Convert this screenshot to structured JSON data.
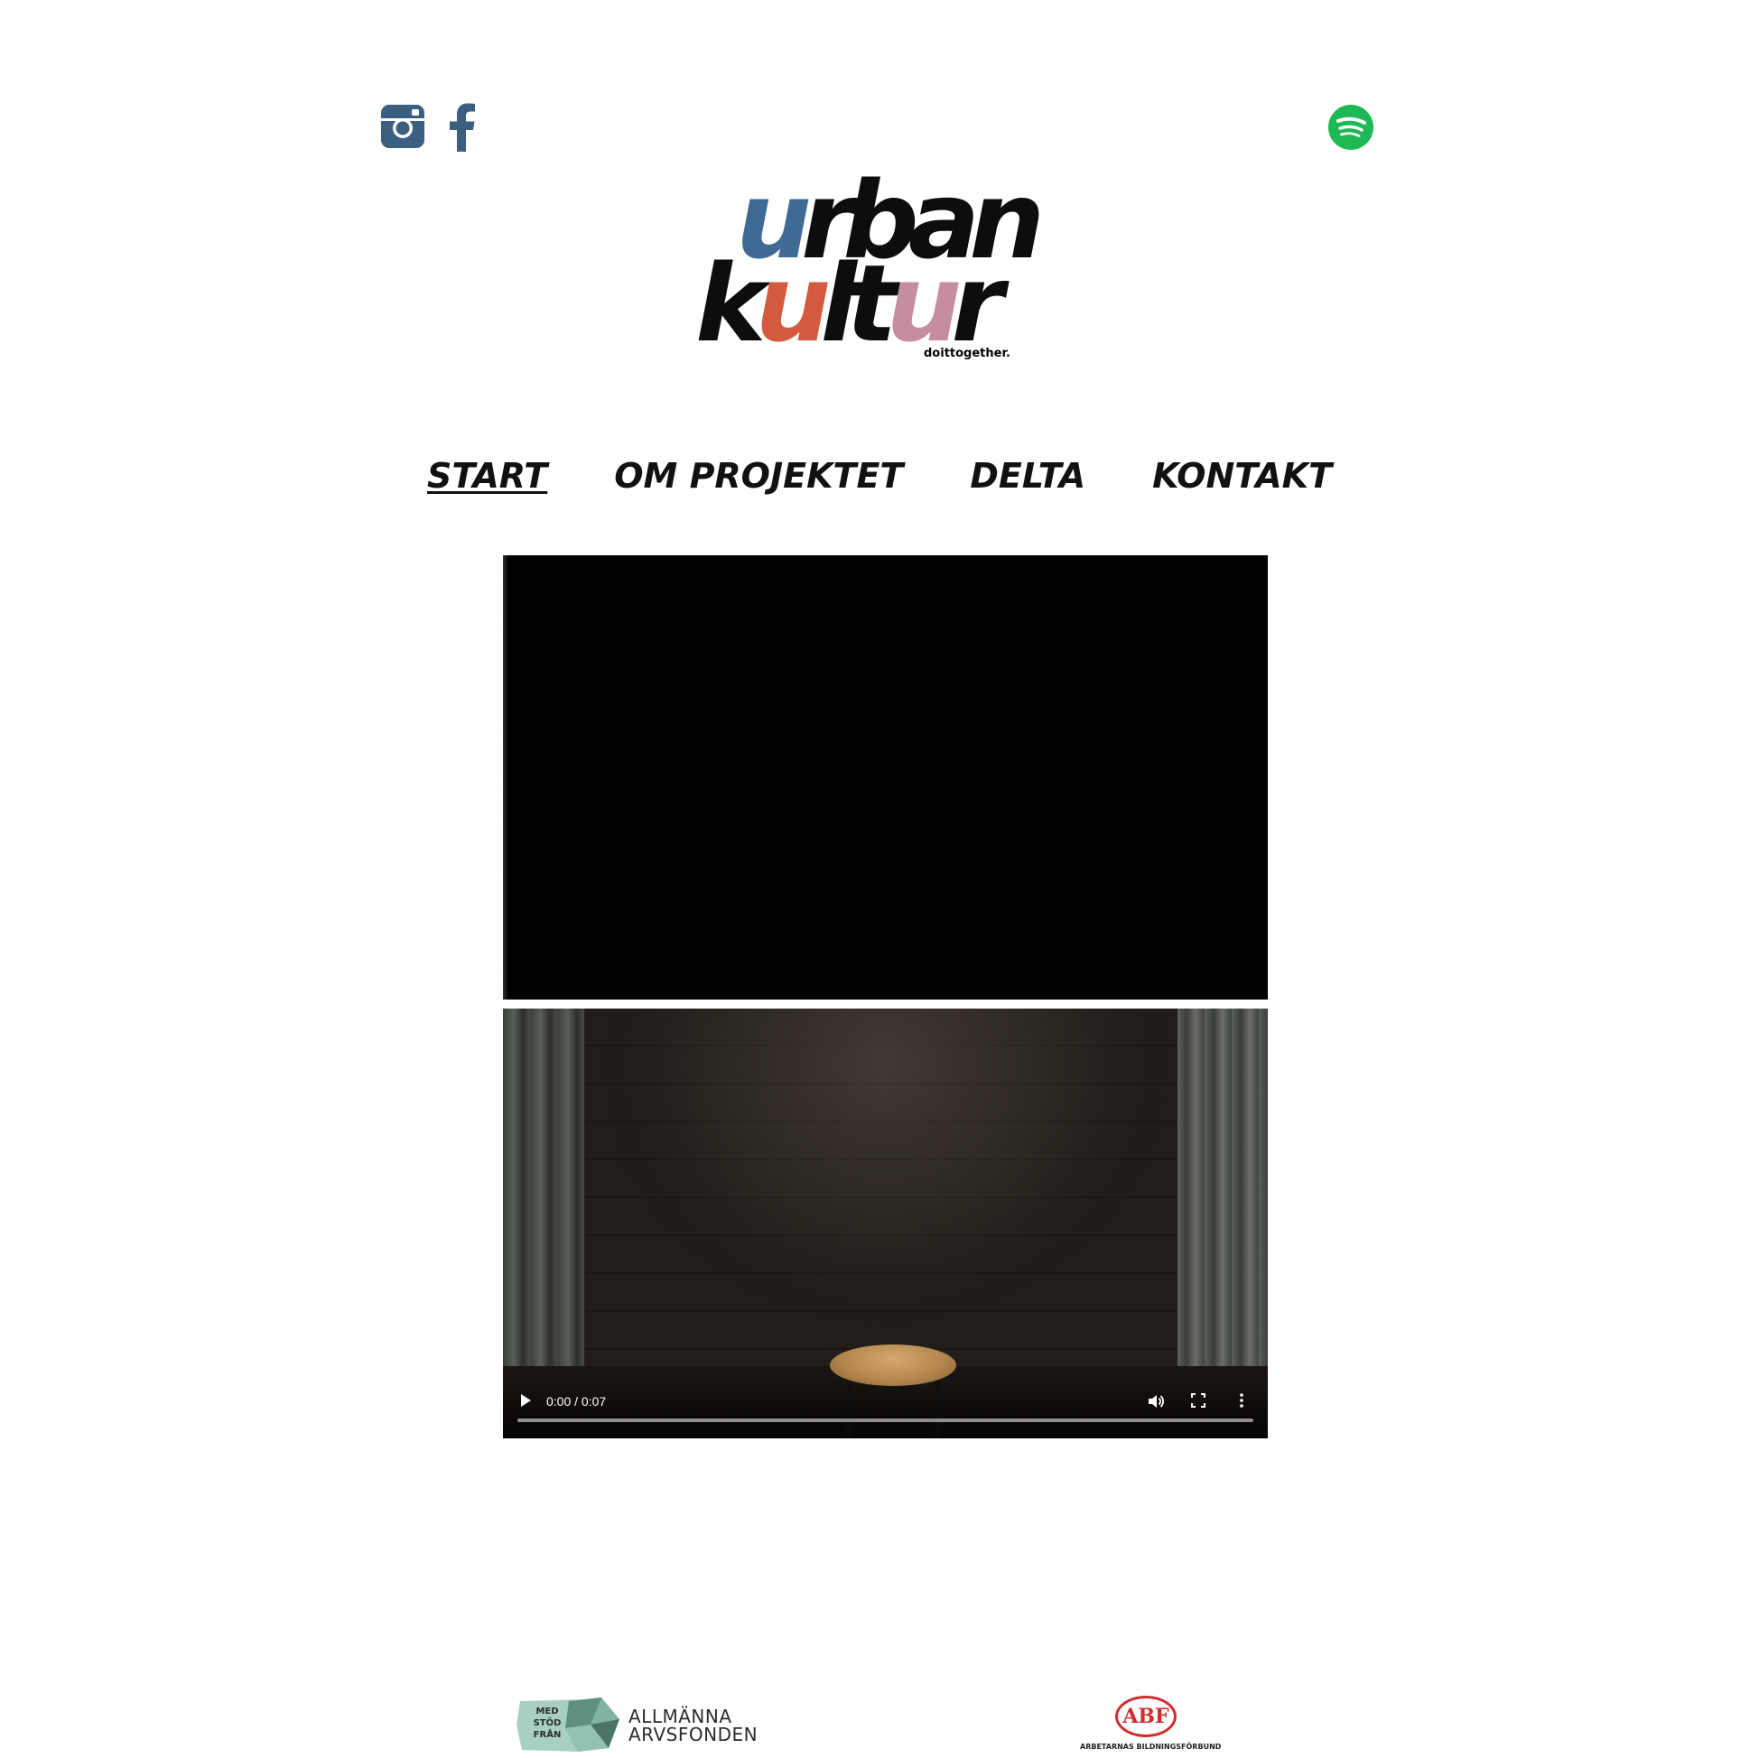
{
  "colors": {
    "social_icon": "#3b5f80",
    "spotify_green": "#1db954",
    "logo_blue": "#3e6a95",
    "logo_orange": "#d35a3e",
    "logo_pink": "#c58e9f",
    "logo_black": "#0d0d0d",
    "abf_red": "#d22b2b"
  },
  "social": {
    "icons": [
      "instagram-icon",
      "facebook-icon"
    ],
    "spotify_icon": "spotify-icon"
  },
  "logo": {
    "line1": [
      "u",
      "rban"
    ],
    "line2": [
      "k",
      "u",
      "lt",
      "u",
      "r"
    ],
    "tagline": "doittogether."
  },
  "nav": {
    "items": [
      {
        "label": "START",
        "active": true
      },
      {
        "label": "OM PROJEKTET",
        "active": false
      },
      {
        "label": "DELTA",
        "active": false
      },
      {
        "label": "KONTAKT",
        "active": false
      }
    ]
  },
  "video_player": {
    "time": "0:00 / 0:07",
    "progress": 0,
    "controls": [
      "play-icon",
      "volume-icon",
      "fullscreen-icon",
      "more-options-icon"
    ]
  },
  "footer": {
    "arvsfonden": {
      "badge_lines": [
        "MED",
        "STÖD",
        "FRÅN"
      ],
      "name_line1": "ALLMÄNNA",
      "name_line2": "ARVSFONDEN"
    },
    "abf": {
      "mark": "ABF",
      "subtitle": "ARBETARNAS BILDNINGSFÖRBUND"
    }
  }
}
